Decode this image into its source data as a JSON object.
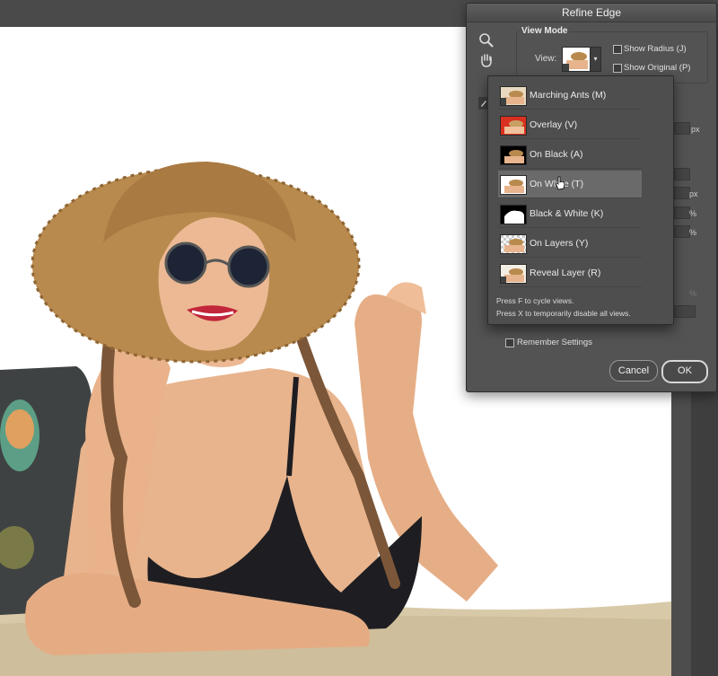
{
  "dialog": {
    "title": "Refine Edge",
    "view_mode": {
      "title": "View Mode",
      "view_label": "View:",
      "show_radius": "Show Radius (J)",
      "show_original": "Show Original (P)"
    },
    "units": {
      "px1": "px",
      "px2": "px",
      "pct1": "%",
      "pct2": "%",
      "pct3": "%"
    },
    "remember_settings": "Remember Settings",
    "cancel": "Cancel",
    "ok": "OK"
  },
  "dropdown": {
    "items": [
      {
        "label": "Marching Ants (M)",
        "thumb": "marching-ants"
      },
      {
        "label": "Overlay (V)",
        "thumb": "overlay"
      },
      {
        "label": "On Black (A)",
        "thumb": "on-black"
      },
      {
        "label": "On White (T)",
        "thumb": "on-white"
      },
      {
        "label": "Black & White (K)",
        "thumb": "black-white"
      },
      {
        "label": "On Layers (Y)",
        "thumb": "on-layers"
      },
      {
        "label": "Reveal Layer (R)",
        "thumb": "reveal-layer"
      }
    ],
    "hover_index": 3,
    "note1": "Press F to cycle views.",
    "note2": "Press X to temporarily disable all views."
  },
  "colors": {
    "panel": "#535353",
    "overlay_red": "#d9301f",
    "skin": "#e8b48d",
    "hat": "#b98a4e",
    "sand": "#d8c9a8"
  },
  "icons": [
    "zoom-icon",
    "hand-icon",
    "brush-icon",
    "chevron-down-icon",
    "pointer-hand-icon"
  ]
}
